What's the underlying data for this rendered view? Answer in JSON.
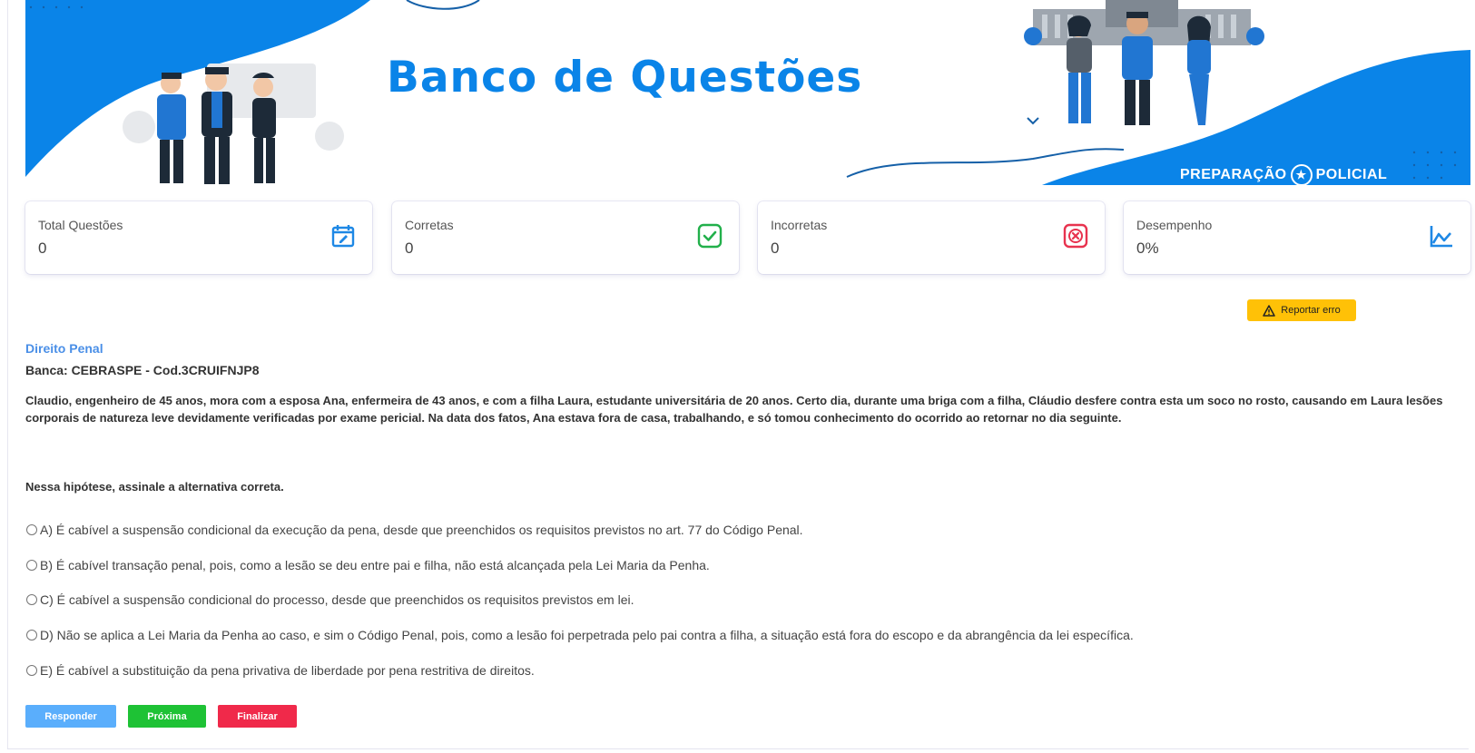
{
  "banner": {
    "title": "Banco de Questões",
    "brand_left": "PREPARAÇÃO",
    "brand_right": "POLICIAL",
    "brand_emblem_icon": "police-star-icon"
  },
  "stats": [
    {
      "label": "Total Questões",
      "value": "0",
      "icon": "edit-calendar-icon",
      "color": "#1e88e5"
    },
    {
      "label": "Corretas",
      "value": "0",
      "icon": "check-square-icon",
      "color": "#22b04b"
    },
    {
      "label": "Incorretas",
      "value": "0",
      "icon": "x-square-icon",
      "color": "#e8334f"
    },
    {
      "label": "Desempenho",
      "value": "0%",
      "icon": "line-chart-icon",
      "color": "#1e88e5"
    }
  ],
  "report_button": {
    "label": "Reportar erro",
    "icon": "warning-triangle-icon",
    "color": "#ffc107"
  },
  "question": {
    "subject": "Direito Penal",
    "banca": "Banca: CEBRASPE - Cod.3CRUIFNJP8",
    "text": "Claudio, engenheiro de 45 anos, mora com a esposa Ana, enfermeira de 43 anos, e com a filha Laura, estudante universitária de 20 anos. Certo dia, durante uma briga com a filha, Cláudio desfere contra esta um soco no rosto, causando em Laura lesões corporais de natureza leve devidamente verificadas por exame pericial. Na data dos fatos, Ana estava fora de casa, trabalhando, e só tomou conhecimento do ocorrido ao retornar no dia seguinte.",
    "prompt": "Nessa hipótese, assinale a alternativa correta.",
    "options": [
      "A) É cabível a suspensão condicional da execução da pena, desde que preenchidos os requisitos previstos no art. 77 do Código Penal.",
      "B) É cabível transação penal, pois, como a lesão se deu entre pai e filha, não está alcançada pela Lei Maria da Penha.",
      "C) É cabível a suspensão condicional do processo, desde que preenchidos os requisitos previstos em lei.",
      "D) Não se aplica a Lei Maria da Penha ao caso, e sim o Código Penal, pois, como a lesão foi perpetrada pelo pai contra a filha, a situação está fora do escopo e da abrangência da lei específica.",
      "E) É cabível a substituição da pena privativa de liberdade por pena restritiva de direitos."
    ]
  },
  "actions": {
    "respond": {
      "label": "Responder",
      "color": "#5aaefc"
    },
    "next": {
      "label": "Próxima",
      "color": "#1ec235"
    },
    "finish": {
      "label": "Finalizar",
      "color": "#f0294a"
    }
  }
}
